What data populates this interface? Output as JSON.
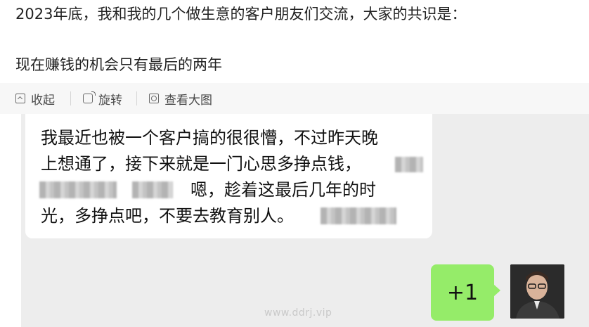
{
  "post": {
    "line1": "2023年底，我和我的几个做生意的客户朋友们交流，大家的共识是：",
    "line2": "现在赚钱的机会只有最后的两年"
  },
  "toolbar": {
    "collapse_label": "收起",
    "rotate_label": "旋转",
    "view_label": "查看大图"
  },
  "chat": {
    "left_bubble": {
      "line1": "我最近也被一个客户搞的很很懵，不过昨天晚",
      "line2": "上想通了，接下来就是一门心思多挣点钱，",
      "line3": "嗯，趁着这最后几年的时",
      "line4": "光，多挣点吧，不要去教育别人。"
    },
    "right_bubble": {
      "text": "+1"
    }
  },
  "watermark": "www.ddrj.vip"
}
